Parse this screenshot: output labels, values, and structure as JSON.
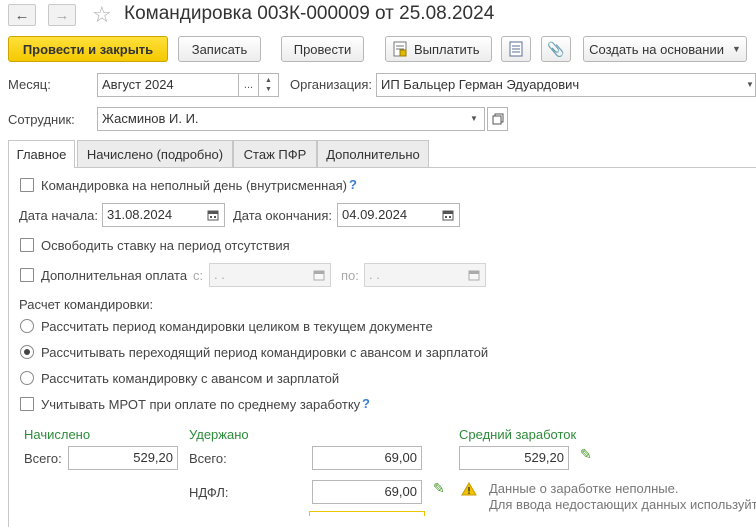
{
  "header": {
    "back_icon": "arrow-left-icon",
    "forward_icon": "arrow-right-icon",
    "star_icon": "star-icon",
    "title": "Командировка 003К-000009 от 25.08.2024"
  },
  "toolbar": {
    "post_close": "Провести и закрыть",
    "save": "Записать",
    "post": "Провести",
    "pay": "Выплатить",
    "create_based_on": "Создать на основании"
  },
  "fields": {
    "month_label": "Месяц:",
    "month_value": "Август 2024",
    "org_label": "Организация:",
    "org_value": "ИП Бальцер Герман Эдуардович",
    "employee_label": "Сотрудник:",
    "employee_value": "Жасминов И. И.",
    "ellipsis": "..."
  },
  "tabs": [
    {
      "label": "Главное"
    },
    {
      "label": "Начислено (подробно)"
    },
    {
      "label": "Стаж ПФР"
    },
    {
      "label": "Дополнительно"
    }
  ],
  "main": {
    "partial_day": "Командировка на неполный день (внутрисменная)",
    "help_mark": "?",
    "date_start_label": "Дата начала:",
    "date_start": "31.08.2024",
    "date_end_label": "Дата окончания:",
    "date_end": "04.09.2024",
    "free_rate": "Освободить ставку на период отсутствия",
    "extra_pay": "Дополнительная оплата",
    "from_label": "с:",
    "to_label": "по:",
    "empty_date": " .  .",
    "calc_title": "Расчет командировки:",
    "radio_options": [
      "Рассчитать период командировки целиком в текущем документе",
      "Рассчитывать переходящий период командировки с авансом и зарплатой",
      "Рассчитать командировку с авансом и зарплатой"
    ],
    "mrot": "Учитывать МРОТ при оплате по среднему заработку"
  },
  "totals": {
    "accrued_title": "Начислено",
    "withheld_title": "Удержано",
    "avg_title": "Средний заработок",
    "total_label": "Всего:",
    "accrued_total": "529,20",
    "withheld_total": "69,00",
    "avg_value": "529,20",
    "ndfl_label": "НДФЛ:",
    "ndfl_value": "69,00",
    "warning_line1": "Данные о заработке неполные.",
    "warning_line2": "Для ввода недостающих данных используйте"
  },
  "colors": {
    "accent": "#f4c900",
    "green": "#2e8b3a",
    "help": "#3a7fd5"
  }
}
